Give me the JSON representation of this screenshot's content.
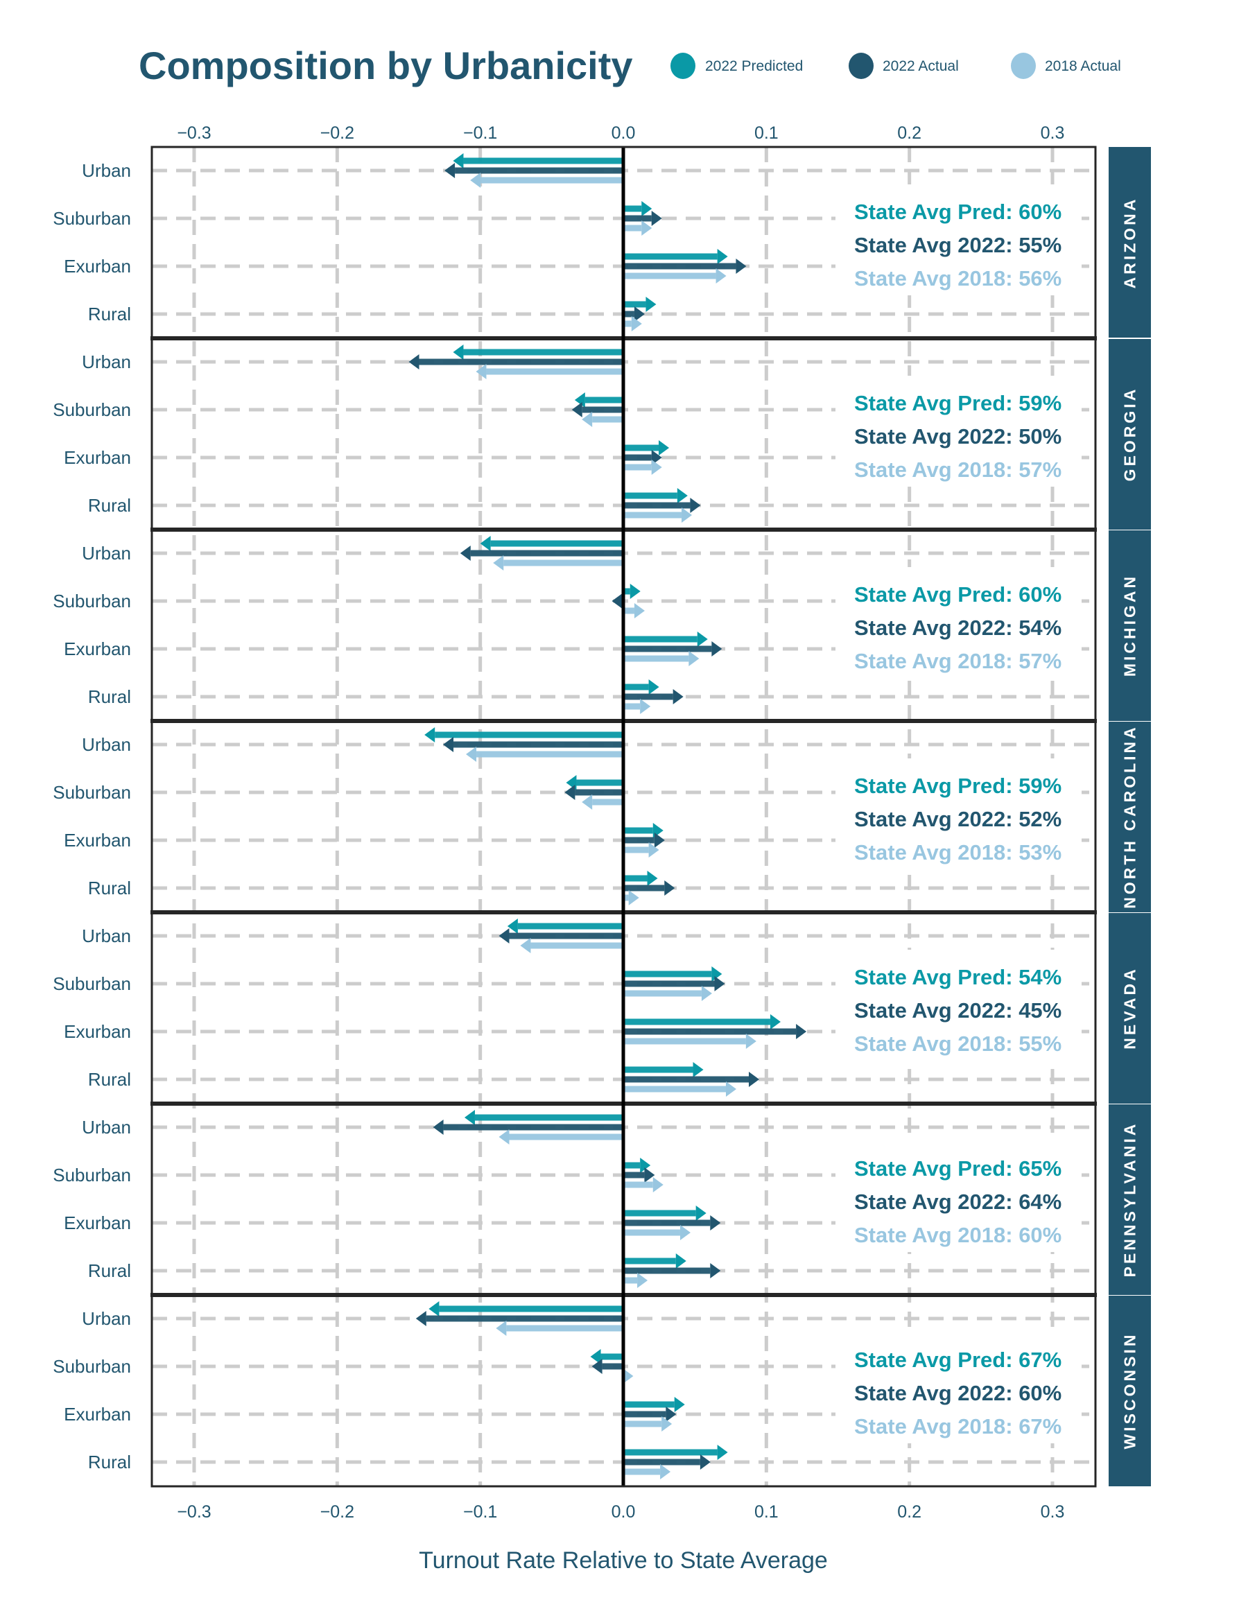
{
  "chart_data": {
    "type": "bar",
    "subtype": "faceted horizontal arrow chart",
    "title": "Composition by Urbanicity",
    "xlabel": "Turnout Rate Relative to State Average",
    "ylabel": "",
    "xlim": [
      -0.33,
      0.33
    ],
    "xticks": [
      -0.3,
      -0.2,
      -0.1,
      0.0,
      0.1,
      0.2,
      0.3
    ],
    "xtick_labels": [
      "−0.3",
      "−0.2",
      "−0.1",
      "0.0",
      "0.1",
      "0.2",
      "0.3"
    ],
    "grid": true,
    "legend_position": "top-right",
    "categories": [
      "Urban",
      "Suburban",
      "Exurban",
      "Rural"
    ],
    "series_meta": [
      {
        "key": "pred",
        "name": "2022 Predicted",
        "color": "#0a99a6"
      },
      {
        "key": "act22",
        "name": "2022 Actual",
        "color": "#22566f"
      },
      {
        "key": "act18",
        "name": "2018 Actual",
        "color": "#98c6e0"
      }
    ],
    "panels": [
      {
        "state": "ARIZONA",
        "annotations": {
          "pred": "State Avg Pred: 60%",
          "act22": "State Avg 2022: 55%",
          "act18": "State Avg 2018: 56%"
        },
        "series": [
          {
            "name": "2022 Predicted",
            "values": [
              -0.119,
              0.02,
              0.073,
              0.023
            ]
          },
          {
            "name": "2022 Actual",
            "values": [
              -0.125,
              0.027,
              0.086,
              0.015
            ]
          },
          {
            "name": "2018 Actual",
            "values": [
              -0.107,
              0.02,
              0.072,
              0.013
            ]
          }
        ]
      },
      {
        "state": "GEORGIA",
        "annotations": {
          "pred": "State Avg Pred: 59%",
          "act22": "State Avg 2022: 50%",
          "act18": "State Avg 2018: 57%"
        },
        "series": [
          {
            "name": "2022 Predicted",
            "values": [
              -0.119,
              -0.034,
              0.032,
              0.045
            ]
          },
          {
            "name": "2022 Actual",
            "values": [
              -0.15,
              -0.036,
              0.027,
              0.054
            ]
          },
          {
            "name": "2018 Actual",
            "values": [
              -0.103,
              -0.029,
              0.027,
              0.048
            ]
          }
        ]
      },
      {
        "state": "MICHIGAN",
        "annotations": {
          "pred": "State Avg Pred: 60%",
          "act22": "State Avg 2022: 54%",
          "act18": "State Avg 2018: 57%"
        },
        "series": [
          {
            "name": "2022 Predicted",
            "values": [
              -0.1,
              0.012,
              0.059,
              0.025
            ]
          },
          {
            "name": "2022 Actual",
            "values": [
              -0.114,
              -0.008,
              0.069,
              0.042
            ]
          },
          {
            "name": "2018 Actual",
            "values": [
              -0.091,
              0.015,
              0.053,
              0.019
            ]
          }
        ]
      },
      {
        "state": "NORTH CAROLINA",
        "annotations": {
          "pred": "State Avg Pred: 59%",
          "act22": "State Avg 2022: 52%",
          "act18": "State Avg 2018: 53%"
        },
        "series": [
          {
            "name": "2022 Predicted",
            "values": [
              -0.139,
              -0.04,
              0.028,
              0.024
            ]
          },
          {
            "name": "2022 Actual",
            "values": [
              -0.126,
              -0.041,
              0.029,
              0.036
            ]
          },
          {
            "name": "2018 Actual",
            "values": [
              -0.11,
              -0.029,
              0.025,
              0.011
            ]
          }
        ]
      },
      {
        "state": "NEVADA",
        "annotations": {
          "pred": "State Avg Pred: 54%",
          "act22": "State Avg 2022: 45%",
          "act18": "State Avg 2018: 55%"
        },
        "series": [
          {
            "name": "2022 Predicted",
            "values": [
              -0.081,
              0.069,
              0.11,
              0.056
            ]
          },
          {
            "name": "2022 Actual",
            "values": [
              -0.087,
              0.071,
              0.128,
              0.095
            ]
          },
          {
            "name": "2018 Actual",
            "values": [
              -0.072,
              0.062,
              0.093,
              0.079
            ]
          }
        ]
      },
      {
        "state": "PENNSYLVANIA",
        "annotations": {
          "pred": "State Avg Pred: 65%",
          "act22": "State Avg 2022: 64%",
          "act18": "State Avg 2018: 60%"
        },
        "series": [
          {
            "name": "2022 Predicted",
            "values": [
              -0.111,
              0.019,
              0.058,
              0.044
            ]
          },
          {
            "name": "2022 Actual",
            "values": [
              -0.133,
              0.022,
              0.068,
              0.068
            ]
          },
          {
            "name": "2018 Actual",
            "values": [
              -0.087,
              0.028,
              0.047,
              0.017
            ]
          }
        ]
      },
      {
        "state": "WISCONSIN",
        "annotations": {
          "pred": "State Avg Pred: 67%",
          "act22": "State Avg 2022: 60%",
          "act18": "State Avg 2018: 67%"
        },
        "series": [
          {
            "name": "2022 Predicted",
            "values": [
              -0.136,
              -0.023,
              0.043,
              0.073
            ]
          },
          {
            "name": "2022 Actual",
            "values": [
              -0.145,
              -0.022,
              0.037,
              0.061
            ]
          },
          {
            "name": "2018 Actual",
            "values": [
              -0.089,
              0.007,
              0.034,
              0.033
            ]
          }
        ]
      }
    ]
  },
  "legend": {
    "items": [
      {
        "label": "2022 Predicted",
        "color": "#0a99a6"
      },
      {
        "label": "2022 Actual",
        "color": "#22566f"
      },
      {
        "label": "2018 Actual",
        "color": "#98c6e0"
      }
    ]
  },
  "colors": {
    "text": "#22566f",
    "strip": "#22566f",
    "grid": "#cccccc",
    "frame": "#262626"
  }
}
